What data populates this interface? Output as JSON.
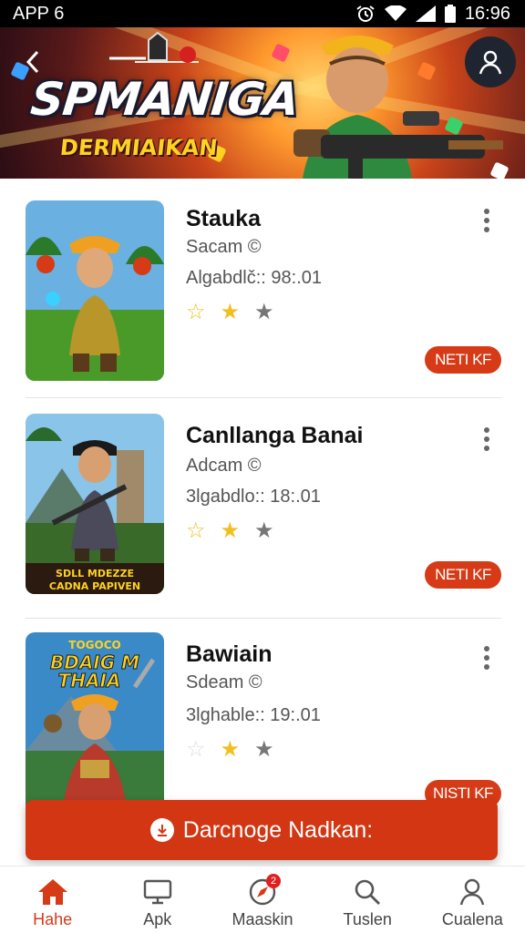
{
  "status_bar": {
    "app_label": "APP 6",
    "time": "16:96"
  },
  "hero": {
    "title": "SPMANIGA",
    "subtitle": "DERMIAIKAN"
  },
  "games": [
    {
      "title": "Stauka",
      "developer": "Sacam ©",
      "meta": "Algabdlč:: 98:.01",
      "stars": [
        "outline",
        "filled",
        "grey"
      ],
      "install_label": "NETI KF"
    },
    {
      "title": "Canllanga Banai",
      "developer": "Adcam ©",
      "meta": "3lgabdlo:: 18:.01",
      "stars": [
        "outline",
        "filled",
        "grey"
      ],
      "install_label": "NETI KF",
      "thumb_text": "SDLL MDEZZE\nCADNA PAPIVEN"
    },
    {
      "title": "Bawiain",
      "developer": "Sdeam ©",
      "meta": "3lghable:: 19:.01",
      "stars": [
        "faint",
        "filled",
        "grey"
      ],
      "install_label": "NISTI KF",
      "thumb_text": "TOGOCO\nBDAIG M\nTHAIA"
    }
  ],
  "download_bar": {
    "label": "Darcnoge Nadkan:"
  },
  "nav": [
    {
      "label": "Hahe",
      "icon": "home-icon",
      "active": true
    },
    {
      "label": "Apk",
      "icon": "monitor-icon"
    },
    {
      "label": "Maaskin",
      "icon": "compass-icon",
      "badge": "2"
    },
    {
      "label": "Tuslen",
      "icon": "search-icon"
    },
    {
      "label": "Cualena",
      "icon": "profile-icon"
    }
  ],
  "colors": {
    "accent": "#d63a16",
    "star": "#f0c020"
  }
}
